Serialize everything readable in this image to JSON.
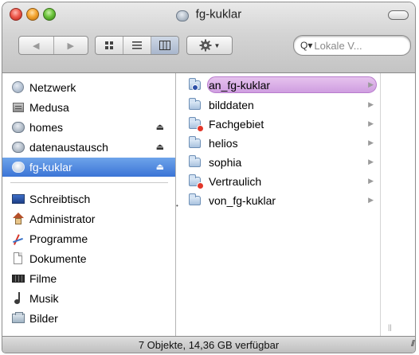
{
  "window": {
    "title": "fg-kuklar"
  },
  "toolbar": {
    "search_placeholder": "Lokale V...",
    "views": [
      "icon",
      "list",
      "column"
    ],
    "active_view": "column"
  },
  "sidebar": {
    "devices": [
      {
        "label": "Netzwerk",
        "icon": "network-globe-icon",
        "eject": false
      },
      {
        "label": "Medusa",
        "icon": "server-icon",
        "eject": false
      },
      {
        "label": "homes",
        "icon": "network-drive-icon",
        "eject": true
      },
      {
        "label": "datenaustausch",
        "icon": "network-drive-icon",
        "eject": true
      },
      {
        "label": "fg-kuklar",
        "icon": "network-drive-icon",
        "eject": true,
        "selected": true
      }
    ],
    "places": [
      {
        "label": "Schreibtisch",
        "icon": "desktop-icon"
      },
      {
        "label": "Administrator",
        "icon": "home-icon"
      },
      {
        "label": "Programme",
        "icon": "applications-icon"
      },
      {
        "label": "Dokumente",
        "icon": "document-icon"
      },
      {
        "label": "Filme",
        "icon": "film-icon"
      },
      {
        "label": "Musik",
        "icon": "music-icon"
      },
      {
        "label": "Bilder",
        "icon": "pictures-icon"
      }
    ]
  },
  "column": {
    "items": [
      {
        "label": "an_fg-kuklar",
        "badge": "blue",
        "highlighted": true
      },
      {
        "label": "bilddaten",
        "badge": "none"
      },
      {
        "label": "Fachgebiet",
        "badge": "red"
      },
      {
        "label": "helios",
        "badge": "none"
      },
      {
        "label": "sophia",
        "badge": "none"
      },
      {
        "label": "Vertraulich",
        "badge": "red"
      },
      {
        "label": "von_fg-kuklar",
        "badge": "none"
      }
    ]
  },
  "status": {
    "text": "7 Objekte, 14,36 GB verfügbar"
  },
  "colors": {
    "selection": "#3b74d6",
    "label_highlight": "#cf9ee0",
    "badge_red": "#e2372a"
  }
}
